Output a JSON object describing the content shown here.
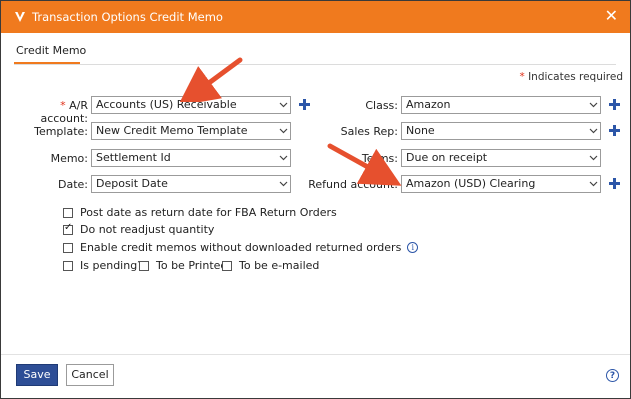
{
  "dialog": {
    "title": "Transaction Options Credit Memo",
    "close_glyph": "✕",
    "tab_label": "Credit Memo",
    "required_note": "Indicates required",
    "required_star": "*",
    "accent_color": "#f07a1e"
  },
  "fields": {
    "ar_account": {
      "label": "A/R account:",
      "value": "Accounts (US) Receivable"
    },
    "template": {
      "label": "Template:",
      "value": "New Credit Memo Template"
    },
    "memo": {
      "label": "Memo:",
      "value": "Settlement Id"
    },
    "date": {
      "label": "Date:",
      "value": "Deposit Date"
    },
    "class": {
      "label": "Class:",
      "value": "Amazon"
    },
    "sales_rep": {
      "label": "Sales Rep:",
      "value": "None"
    },
    "terms": {
      "label": "Terms:",
      "value": "Due on receipt"
    },
    "refund_account": {
      "label": "Refund account:",
      "value": "Amazon (USD) Clearing"
    }
  },
  "options": {
    "post_date": {
      "label": "Post date as return date for FBA Return Orders",
      "checked": false
    },
    "no_readjust": {
      "label": "Do not readjust quantity",
      "checked": true
    },
    "enable_credit": {
      "label": "Enable credit memos without downloaded returned orders",
      "checked": false
    },
    "is_pending": {
      "label": "Is pending?",
      "checked": false
    },
    "to_be_printed": {
      "label": "To be Printed",
      "checked": false
    },
    "to_be_emailed": {
      "label": "To be e-mailed",
      "checked": false
    }
  },
  "footer": {
    "save_label": "Save",
    "cancel_label": "Cancel",
    "help_glyph": "?"
  },
  "icons": {
    "chevron": "chevron-down-icon",
    "plus": "plus-icon",
    "info": "info-icon",
    "help": "help-icon"
  }
}
